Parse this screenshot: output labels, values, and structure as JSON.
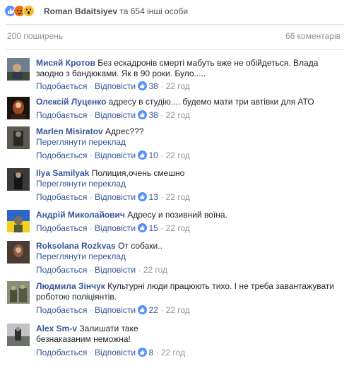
{
  "header": {
    "reactions": [
      "like-icon",
      "angry-icon",
      "wow-icon"
    ],
    "reactor_name": "Roman Bdaitsiyev",
    "reactor_rest": " та 654 інші особи"
  },
  "stats": {
    "shares": "200 поширень",
    "comments": "66 коментарів"
  },
  "labels": {
    "like": "Подобається",
    "reply": "Відповісти",
    "translate": "Переглянути переклад",
    "dot": "·"
  },
  "comments": [
    {
      "author": "Мисяй Кротов",
      "text": "Без ескадронів смерті мабуть вже не обійдеться. Влада заодно з бандюками. Як в 90 роки. Було.....",
      "likes": "38",
      "time": "22 год",
      "translate": ""
    },
    {
      "author": "Олексій Луценко",
      "text": "адресу в студію.... будемо мати три автівки для АТО",
      "likes": "38",
      "time": "22 год",
      "translate": ""
    },
    {
      "author": "Marlen Misiratov",
      "text": "Адрес???",
      "likes": "10",
      "time": "22 год",
      "translate": "Переглянути переклад"
    },
    {
      "author": "Ilya Samilyak",
      "text": "Полиция,очень смешно",
      "likes": "13",
      "time": "22 год",
      "translate": "Переглянути переклад"
    },
    {
      "author": "Андрій Миколайович",
      "text": "Адресу и позивний воїна.",
      "likes": "15",
      "time": "22 год",
      "translate": ""
    },
    {
      "author": "Roksolana Rozkvas",
      "text": "От собаки..",
      "likes": "",
      "time": "22 год",
      "translate": "Переглянути переклад"
    },
    {
      "author": "Людмила Зінчук",
      "text": "Культурні люди працюють тихо. І не треба завантажувати роботою поліціянтів.",
      "likes": "22",
      "time": "22 год",
      "translate": ""
    },
    {
      "author": "Alex Sm-v",
      "text": "Залишати таке безнаказаним неможна!",
      "likes": "8",
      "time": "22 год",
      "translate": ""
    }
  ],
  "colors": {
    "link": "#365899",
    "meta": "#90949c",
    "like": "#5890ff"
  }
}
